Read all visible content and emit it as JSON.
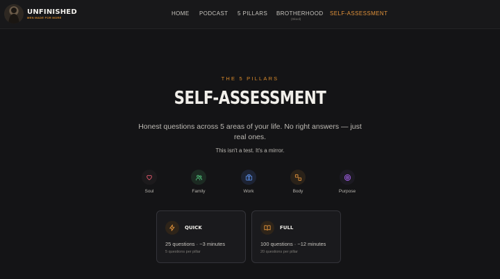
{
  "brand": {
    "name": "UNFINISHED",
    "tagline": "MEN MADE FOR MORE"
  },
  "nav": {
    "items": [
      {
        "label": "HOME"
      },
      {
        "label": "PODCAST"
      },
      {
        "label": "5 PILLARS"
      },
      {
        "label": "BROTHERHOOD",
        "sub": "(Skool)"
      },
      {
        "label": "SELF-ASSESSMENT",
        "active": true
      }
    ]
  },
  "hero": {
    "eyebrow": "THE 5 PILLARS",
    "title": "SELF-ASSESSMENT",
    "subtitle": "Honest questions across 5 areas of your life. No right answers — just real ones.",
    "note": "This isn't a test. It's a mirror."
  },
  "pillars": [
    {
      "label": "Soul",
      "icon": "heart-icon",
      "color": "#e0566b",
      "bg": "#1c1a1c"
    },
    {
      "label": "Family",
      "icon": "people-icon",
      "color": "#4fbf7a",
      "bg": "#1c2a22"
    },
    {
      "label": "Work",
      "icon": "briefcase-icon",
      "color": "#5b8ee6",
      "bg": "#1d2333"
    },
    {
      "label": "Body",
      "icon": "dumbbell-icon",
      "color": "#e0913a",
      "bg": "#2a2219"
    },
    {
      "label": "Purpose",
      "icon": "target-icon",
      "color": "#a15ee6",
      "bg": "#1c1a22"
    }
  ],
  "modes": [
    {
      "name": "QUICK",
      "icon": "lightning-icon",
      "meta": "25 questions · ~3 minutes",
      "sub": "5 questions per pillar",
      "color": "#e0913a",
      "bg": "#2e2419"
    },
    {
      "name": "FULL",
      "icon": "book-icon",
      "meta": "100 questions · ~12 minutes",
      "sub": "20 questions per pillar",
      "color": "#e0913a",
      "bg": "#2e2419"
    }
  ]
}
